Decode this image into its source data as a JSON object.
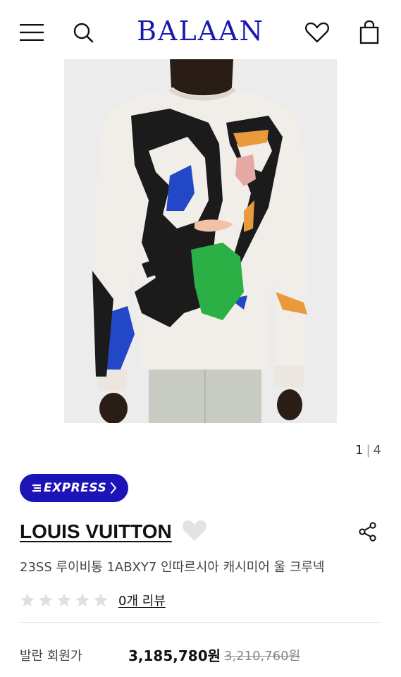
{
  "header": {
    "logo": "BALAAN",
    "logo_color": "#1a1ab0",
    "icons": [
      "menu-icon",
      "search-icon",
      "heart-icon",
      "shopping-bag-icon"
    ]
  },
  "gallery": {
    "current": "1",
    "separator": "|",
    "total": "4"
  },
  "badge": {
    "label": "EXPRESS",
    "color": "#1c14b5"
  },
  "product": {
    "brand": "LOUIS VUITTON",
    "name": "23SS 루이비통 1ABXY7 인따르시아 캐시미어 울 크루넥",
    "rating_stars": 0,
    "rating_max": 5,
    "review_link": "0개 리뷰"
  },
  "price": {
    "label": "발란 회원가",
    "sale": "3,185,780원",
    "original": "3,210,760원"
  }
}
